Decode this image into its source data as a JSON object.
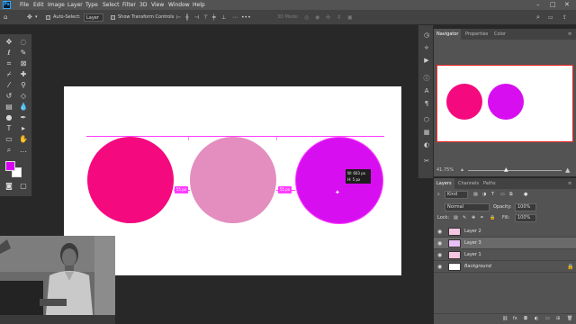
{
  "menubar": {
    "logo": "Ps",
    "items": [
      "File",
      "Edit",
      "Image",
      "Layer",
      "Type",
      "Select",
      "Filter",
      "3D",
      "View",
      "Window",
      "Help"
    ],
    "window_controls": [
      "–",
      "□",
      "✕"
    ]
  },
  "options": {
    "auto_select_label": "Auto-Select:",
    "auto_select_value": "Layer",
    "show_transform_label": "Show Transform Controls",
    "mode_label": "3D Mode:"
  },
  "canvas": {
    "circles": [
      {
        "name": "circle-hot-pink",
        "color": "#f5097f"
      },
      {
        "name": "circle-light-pink",
        "color": "#e38ebf"
      },
      {
        "name": "circle-purple",
        "color": "#d70ff0"
      }
    ],
    "distance_label_1": "55 px",
    "distance_label_2": "55 px",
    "tooltip_w": "W: 603 px",
    "tooltip_h": "H: 5 px"
  },
  "panels": {
    "nav_tabs": [
      "Navigator",
      "Properties",
      "Color"
    ],
    "zoom_value": "41.75%",
    "layers_tabs": [
      "Layers",
      "Channels",
      "Paths"
    ],
    "kind_label": "Kind",
    "blend_mode": "Normal",
    "opacity_label": "Opacity:",
    "opacity_value": "100%",
    "lock_label": "Lock:",
    "fill_label": "Fill:",
    "fill_value": "100%",
    "layers": [
      "Layer 2",
      "Layer 3",
      "Layer 1",
      "Background"
    ],
    "selected_layer_index": 1
  },
  "colors": {
    "foreground": "#d700f0",
    "background": "#ffffff",
    "accent_guides": "#ff3cff"
  }
}
